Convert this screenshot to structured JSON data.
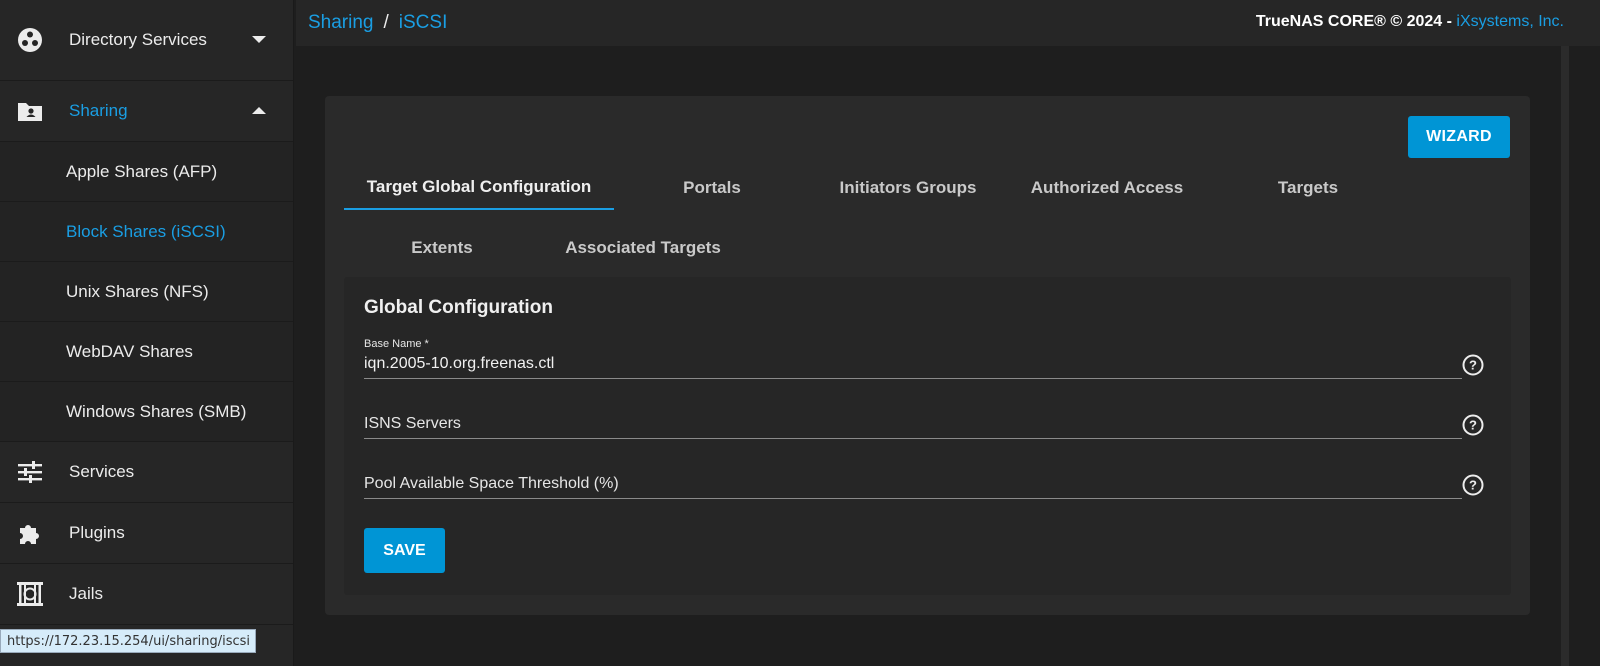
{
  "sidebar": {
    "items": [
      {
        "label": "Directory Services",
        "icon": "directory-services-icon"
      },
      {
        "label": "Sharing",
        "icon": "sharing-folder-icon"
      },
      {
        "label": "Services",
        "icon": "tune-sliders-icon"
      },
      {
        "label": "Plugins",
        "icon": "puzzle-icon"
      },
      {
        "label": "Jails",
        "icon": "jail-icon"
      }
    ],
    "sharing_sub": [
      {
        "label": "Apple Shares (AFP)"
      },
      {
        "label": "Block Shares (iSCSI)"
      },
      {
        "label": "Unix Shares (NFS)"
      },
      {
        "label": "WebDAV Shares"
      },
      {
        "label": "Windows Shares (SMB)"
      }
    ]
  },
  "status_url": "https://172.23.15.254/ui/sharing/iscsi",
  "header": {
    "breadcrumb": [
      "Sharing",
      "iSCSI"
    ],
    "breadcrumb_sep": "/",
    "copyright": "TrueNAS CORE® © 2024 - ",
    "company": "iXsystems, Inc."
  },
  "card": {
    "wizard_label": "WIZARD",
    "tabs": [
      {
        "label": "Target Global Configuration"
      },
      {
        "label": "Portals"
      },
      {
        "label": "Initiators Groups"
      },
      {
        "label": "Authorized Access"
      },
      {
        "label": "Targets"
      },
      {
        "label": "Extents"
      },
      {
        "label": "Associated Targets"
      }
    ],
    "active_tab": "Target Global Configuration",
    "form": {
      "title": "Global Configuration",
      "base_name": {
        "label": "Base Name *",
        "value": "iqn.2005-10.org.freenas.ctl"
      },
      "isns_servers": {
        "label": "ISNS Servers",
        "value": ""
      },
      "pool_threshold": {
        "label": "Pool Available Space Threshold (%)",
        "value": ""
      },
      "save_label": "SAVE"
    }
  },
  "colors": {
    "accent": "#1a9ee3",
    "button": "#0095d5",
    "sidebar_bg": "#262626",
    "page_bg": "#1e1e1e"
  }
}
